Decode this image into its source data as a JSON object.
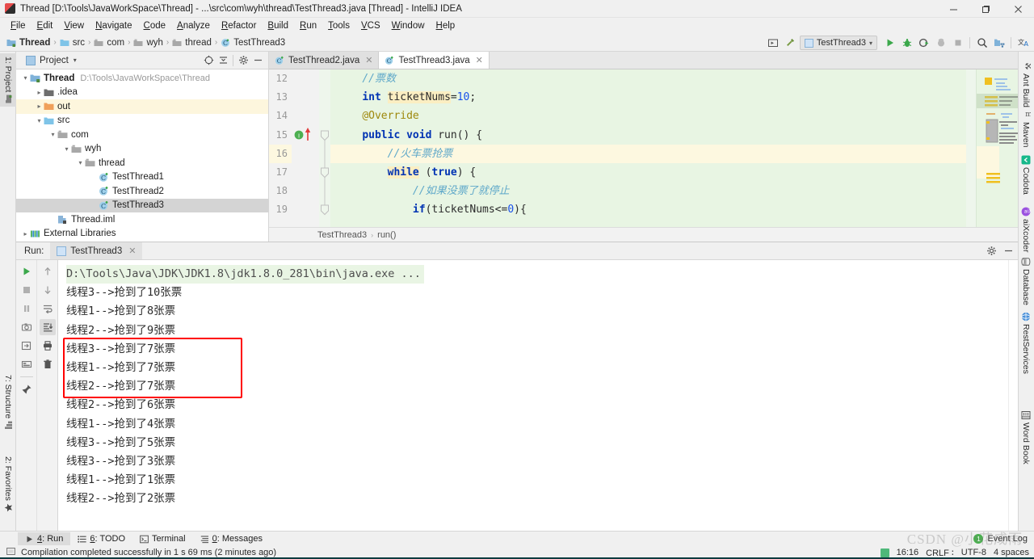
{
  "window": {
    "title": "Thread [D:\\Tools\\JavaWorkSpace\\Thread] - ...\\src\\com\\wyh\\thread\\TestThread3.java [Thread] - IntelliJ IDEA",
    "minimize": "–",
    "maximize": "❐",
    "close": "✕"
  },
  "menu": [
    "File",
    "Edit",
    "View",
    "Navigate",
    "Code",
    "Analyze",
    "Refactor",
    "Build",
    "Run",
    "Tools",
    "VCS",
    "Window",
    "Help"
  ],
  "breadcrumbs": [
    "Thread",
    "src",
    "com",
    "wyh",
    "thread",
    "TestThread3"
  ],
  "toolbar": {
    "run_config": "TestThread3",
    "run_label": "Run",
    "debug_label": "Debug",
    "coverage_label": "Run with Coverage",
    "profile_label": "Profile",
    "stop_label": "Stop",
    "search_label": "Search Everywhere",
    "project_structure_label": "Project Structure",
    "translate_label": "Translate"
  },
  "left_tabs": [
    {
      "label": "1: Project",
      "icon": "project-icon",
      "active": true
    },
    {
      "label": "7: Structure",
      "icon": "structure-icon",
      "active": false
    },
    {
      "label": "2: Favorites",
      "icon": "star-icon",
      "active": false
    }
  ],
  "right_tabs": [
    {
      "label": "Ant Build",
      "icon": "ant-icon"
    },
    {
      "label": "Maven",
      "icon": "maven-icon"
    },
    {
      "label": "Codota",
      "icon": "codota-icon"
    },
    {
      "label": "aiXcoder",
      "icon": "aixcoder-icon"
    },
    {
      "label": "Database",
      "icon": "database-icon"
    },
    {
      "label": "RestServices",
      "icon": "rest-icon"
    },
    {
      "label": "Word Book",
      "icon": "wordbook-icon"
    }
  ],
  "project_panel": {
    "title": "Project",
    "tree": [
      {
        "label": "Thread",
        "sub": "D:\\Tools\\JavaWorkSpace\\Thread",
        "depth": 0,
        "arrow": "⌄",
        "icon": "module-icon",
        "bold": true,
        "state": "normal"
      },
      {
        "label": ".idea",
        "sub": "",
        "depth": 1,
        "arrow": "›",
        "icon": "folder-icon",
        "bold": false,
        "state": "normal"
      },
      {
        "label": "out",
        "sub": "",
        "depth": 1,
        "arrow": "›",
        "icon": "folder-orange-icon",
        "bold": false,
        "state": "highlight"
      },
      {
        "label": "src",
        "sub": "",
        "depth": 1,
        "arrow": "⌄",
        "icon": "folder-source-icon",
        "bold": false,
        "state": "normal"
      },
      {
        "label": "com",
        "sub": "",
        "depth": 2,
        "arrow": "⌄",
        "icon": "package-icon",
        "bold": false,
        "state": "normal"
      },
      {
        "label": "wyh",
        "sub": "",
        "depth": 3,
        "arrow": "⌄",
        "icon": "package-icon",
        "bold": false,
        "state": "normal"
      },
      {
        "label": "thread",
        "sub": "",
        "depth": 4,
        "arrow": "⌄",
        "icon": "package-icon",
        "bold": false,
        "state": "normal"
      },
      {
        "label": "TestThread1",
        "sub": "",
        "depth": 5,
        "arrow": "",
        "icon": "java-class-icon",
        "bold": false,
        "state": "normal"
      },
      {
        "label": "TestThread2",
        "sub": "",
        "depth": 5,
        "arrow": "",
        "icon": "java-class-icon",
        "bold": false,
        "state": "normal"
      },
      {
        "label": "TestThread3",
        "sub": "",
        "depth": 5,
        "arrow": "",
        "icon": "java-class-icon",
        "bold": false,
        "state": "selected"
      },
      {
        "label": "Thread.iml",
        "sub": "",
        "depth": 2,
        "arrow": "",
        "icon": "iml-icon",
        "bold": false,
        "state": "normal"
      },
      {
        "label": "External Libraries",
        "sub": "",
        "depth": 0,
        "arrow": "›",
        "icon": "library-icon",
        "bold": false,
        "state": "normal"
      }
    ]
  },
  "editor": {
    "tabs": [
      {
        "label": "TestThread2.java",
        "active": false
      },
      {
        "label": "TestThread3.java",
        "active": true
      }
    ],
    "lines": [
      {
        "n": "12",
        "indent": 4,
        "highlight": false,
        "tokens": [
          {
            "t": "//票数",
            "c": "cm"
          }
        ]
      },
      {
        "n": "13",
        "indent": 4,
        "highlight": false,
        "tokens": [
          {
            "t": "int ",
            "c": "kw"
          },
          {
            "t": "ticketNums",
            "c": "hlid"
          },
          {
            "t": "=",
            "c": "id"
          },
          {
            "t": "10",
            "c": "num"
          },
          {
            "t": ";",
            "c": "id"
          }
        ]
      },
      {
        "n": "14",
        "indent": 4,
        "highlight": false,
        "tokens": [
          {
            "t": "@Override",
            "c": "an"
          }
        ]
      },
      {
        "n": "15",
        "indent": 4,
        "highlight": false,
        "tokens": [
          {
            "t": "public void ",
            "c": "kw"
          },
          {
            "t": "run() {",
            "c": "id"
          }
        ]
      },
      {
        "n": "16",
        "indent": 8,
        "highlight": true,
        "tokens": [
          {
            "t": "//火车票抢票",
            "c": "cm"
          }
        ]
      },
      {
        "n": "17",
        "indent": 8,
        "highlight": false,
        "tokens": [
          {
            "t": "while",
            "c": "hlkw"
          },
          {
            "t": " (",
            "c": "id"
          },
          {
            "t": "true",
            "c": "kw"
          },
          {
            "t": ") {",
            "c": "id"
          }
        ]
      },
      {
        "n": "18",
        "indent": 12,
        "highlight": false,
        "tokens": [
          {
            "t": "//如果没票了就停止",
            "c": "cm"
          }
        ]
      },
      {
        "n": "19",
        "indent": 12,
        "highlight": false,
        "tokens": [
          {
            "t": "if",
            "c": "kw"
          },
          {
            "t": "(ticketNums<=",
            "c": "id"
          },
          {
            "t": "0",
            "c": "num"
          },
          {
            "t": "){",
            "c": "id"
          }
        ]
      }
    ],
    "breadcrumb": [
      "TestThread3",
      "run()"
    ]
  },
  "run_panel": {
    "label": "Run:",
    "tab": "TestThread3",
    "command": "D:\\Tools\\Java\\JDK\\JDK1.8\\jdk1.8.0_281\\bin\\java.exe ...",
    "output": [
      "线程3-->抢到了10张票",
      "线程1-->抢到了8张票",
      "线程2-->抢到了9张票",
      "线程3-->抢到了7张票",
      "线程1-->抢到了7张票",
      "线程2-->抢到了7张票",
      "线程2-->抢到了6张票",
      "线程1-->抢到了4张票",
      "线程3-->抢到了5张票",
      "线程3-->抢到了3张票",
      "线程1-->抢到了1张票",
      "线程2-->抢到了2张票"
    ],
    "highlight_box": {
      "from_line": 4,
      "to_line": 6,
      "color": "#ff0000"
    },
    "tools": [
      "rerun-icon",
      "stop-icon",
      "pause-icon",
      "camera-icon",
      "export-icon",
      "layout-icon",
      "pin-icon"
    ],
    "tools2": [
      "arrow-up-icon",
      "arrow-down-icon",
      "soft-wrap-icon",
      "scroll-to-end-icon",
      "print-icon",
      "trash-icon"
    ]
  },
  "bottom_tabs": [
    {
      "num": "4",
      "label": "Run",
      "icon": "run-icon",
      "active": true
    },
    {
      "num": "6",
      "label": "TODO",
      "icon": "todo-icon",
      "active": false
    },
    {
      "num": "",
      "label": "Terminal",
      "icon": "terminal-icon",
      "active": false
    },
    {
      "num": "0",
      "label": "Messages",
      "icon": "messages-icon",
      "active": false
    }
  ],
  "event_log": {
    "label": "Event Log",
    "count": "1"
  },
  "status": {
    "message": "Compilation completed successfully in 1 s 69 ms (2 minutes ago)",
    "time": "16:16",
    "line_sep": "CRLF ∶",
    "encoding": "UTF-8",
    "indent": "4 spaces"
  },
  "watermark": "CSDN @小花成雨",
  "colors": {
    "accent_green": "#4caf50",
    "diff_green": "#e8f5e3",
    "caret_row": "#fdf8e0",
    "selection": "#d4d4d4",
    "highlight_red": "#ff0000"
  }
}
